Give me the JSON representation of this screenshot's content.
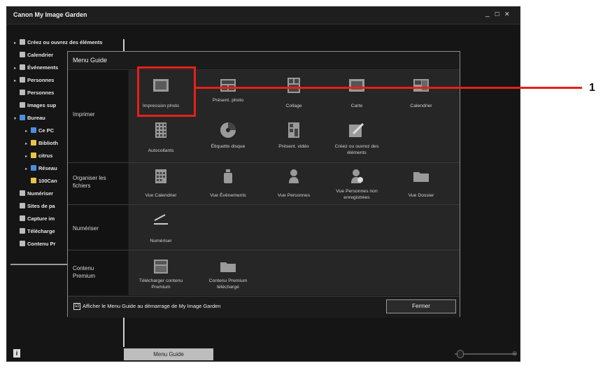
{
  "app": {
    "title": "Canon My Image Garden",
    "minimize": "_",
    "maximize": "☐",
    "close": "✕"
  },
  "tree": [
    {
      "label": "Créez ou ouvrez des éléments",
      "icon": "create-icon"
    },
    {
      "label": "Calendrier",
      "icon": "calendar-icon"
    },
    {
      "label": "Événements",
      "icon": "event-icon"
    },
    {
      "label": "Personnes",
      "icon": "person-icon"
    },
    {
      "label": "Personnes",
      "icon": "person-icon"
    },
    {
      "label": "Images sup",
      "icon": "image-icon"
    },
    {
      "label": "Bureau",
      "icon": "folder-icon"
    },
    {
      "label": "Ce PC",
      "icon": "computer-icon"
    },
    {
      "label": "Biblioth",
      "icon": "library-icon"
    },
    {
      "label": "citrus",
      "icon": "folder-icon"
    },
    {
      "label": "Réseau",
      "icon": "network-icon"
    },
    {
      "label": "100Can",
      "icon": "folder-icon"
    },
    {
      "label": "Numériser",
      "icon": "scan-icon"
    },
    {
      "label": "Sites de pa",
      "icon": "web-icon"
    },
    {
      "label": "Capture im",
      "icon": "capture-icon"
    },
    {
      "label": "Télécharge",
      "icon": "download-icon"
    },
    {
      "label": "Contenu Pr",
      "icon": "content-icon"
    }
  ],
  "status": {
    "info": "i",
    "menu_guide_button": "Menu Guide"
  },
  "dialog": {
    "title": "Menu Guide",
    "categories": {
      "print": "Imprimer",
      "organize": "Organiser les fichiers",
      "scan": "Numériser",
      "premium": "Contenu Premium"
    },
    "print_tiles": [
      "Impression photo",
      "Présent. photo",
      "Collage",
      "Carte",
      "Calendrier",
      "Autocollants",
      "Étiquette disque",
      "Présent. vidéo",
      "Créez ou ouvrez des éléments"
    ],
    "organize_tiles": [
      "Vue Calendrier",
      "Vue Événements",
      "Vue Personnes",
      "Vue Personnes non enregistrées",
      "Vue Dossier"
    ],
    "scan_tiles": [
      "Numériser"
    ],
    "premium_tiles": [
      "Télécharger contenu Premium",
      "Contenu Premium téléchargé"
    ],
    "show_on_start": "Afficher le Menu Guide au démarrage de My Image Garden",
    "checkbox_mark": "☑",
    "close_button": "Fermer"
  },
  "callout": {
    "number": "1"
  },
  "colors": {
    "highlight": "#e52019",
    "background": "#151515"
  }
}
